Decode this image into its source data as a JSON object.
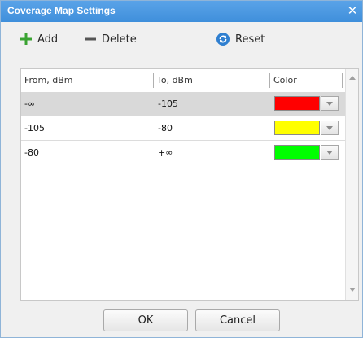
{
  "window": {
    "title": "Coverage Map Settings"
  },
  "toolbar": {
    "add_label": "Add",
    "delete_label": "Delete",
    "reset_label": "Reset"
  },
  "table": {
    "columns": [
      "From, dBm",
      "To, dBm",
      "Color"
    ],
    "rows": [
      {
        "from": "-∞",
        "to": "-105",
        "color": "#ff0000"
      },
      {
        "from": "-105",
        "to": "-80",
        "color": "#ffff00"
      },
      {
        "from": "-80",
        "to": "+∞",
        "color": "#00ff00"
      }
    ],
    "selected_row": 0
  },
  "buttons": {
    "ok": "OK",
    "cancel": "Cancel"
  },
  "colors": {
    "titlebar": "#4a98e0",
    "add_icon": "#3aa332",
    "reset_icon": "#2f7fd0"
  }
}
